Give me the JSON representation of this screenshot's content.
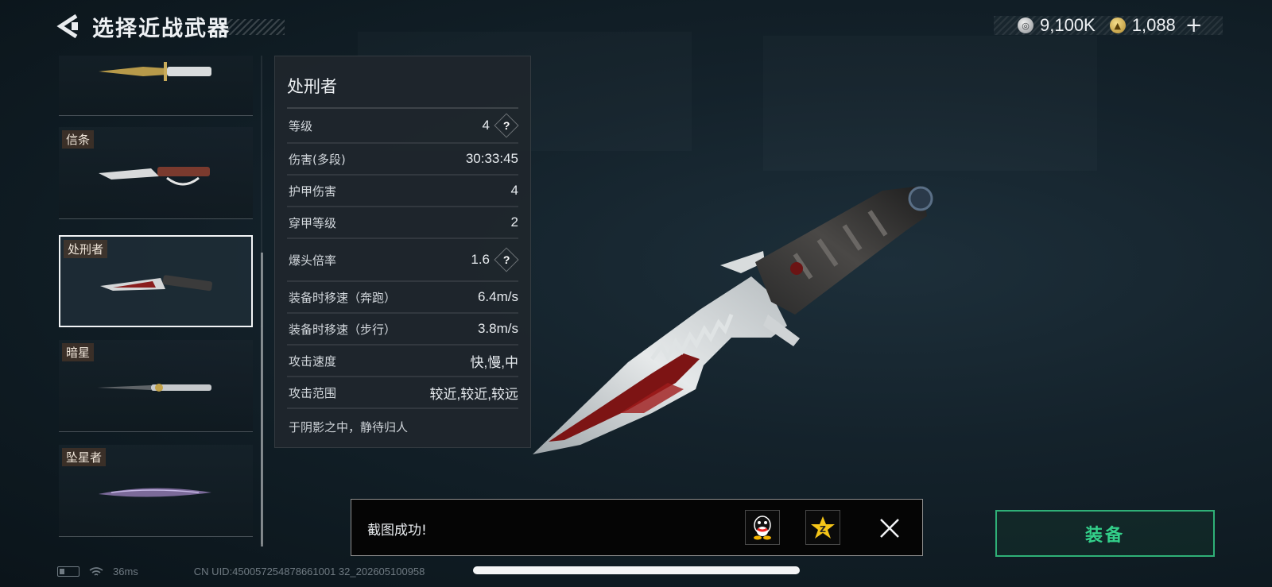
{
  "header": {
    "title": "选择近战武器",
    "currencies": [
      {
        "icon": "silver-coin-icon",
        "value": "9,100K"
      },
      {
        "icon": "gold-coin-icon",
        "value": "1,088"
      }
    ],
    "plus_label": "+"
  },
  "weapon_list": [
    {
      "label": "",
      "selected": false
    },
    {
      "label": "信条",
      "selected": false
    },
    {
      "label": "处刑者",
      "selected": true
    },
    {
      "label": "暗星",
      "selected": false
    },
    {
      "label": "坠星者",
      "selected": false
    }
  ],
  "details": {
    "name": "处刑者",
    "stats": [
      {
        "name": "等级",
        "value": "4",
        "help": true
      },
      {
        "name": "伤害(多段)",
        "value": "30:33:45",
        "help": false
      },
      {
        "name": "护甲伤害",
        "value": "4",
        "help": false
      },
      {
        "name": "穿甲等级",
        "value": "2",
        "help": false
      },
      {
        "name": "爆头倍率",
        "value": "1.6",
        "help": true
      },
      {
        "name": "装备时移速（奔跑）",
        "value": "6.4m/s",
        "help": false
      },
      {
        "name": "装备时移速（步行）",
        "value": "3.8m/s",
        "help": false
      },
      {
        "name": "攻击速度",
        "value": "快,慢,中",
        "help": false
      },
      {
        "name": "攻击范围",
        "value": "较近,较近,较远",
        "help": false
      }
    ],
    "help_label": "?",
    "flavor": "于阴影之中，静待归人"
  },
  "toast": {
    "message": "截图成功!",
    "share_icons": [
      "qq-icon",
      "qzone-icon"
    ]
  },
  "equip_button": {
    "label": "装备"
  },
  "footer": {
    "ping": "36ms",
    "uid": "CN UID:450057254878661001 32_202605100958"
  },
  "colors": {
    "accent_green": "#33d08a",
    "panel_bg": "#20262c"
  }
}
